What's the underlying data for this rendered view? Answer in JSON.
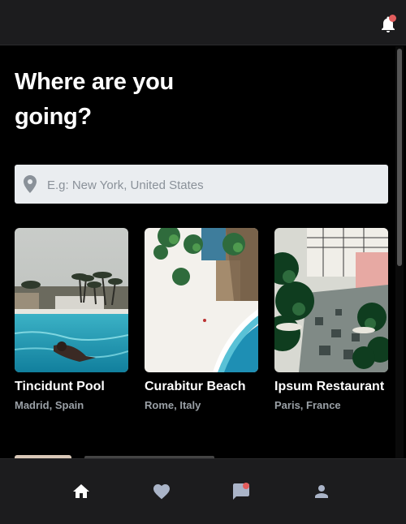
{
  "header": {
    "notification_icon": "bell-icon",
    "has_unread": true
  },
  "main": {
    "heading": "Where are you going?",
    "search": {
      "placeholder": "E.g: New York, United States",
      "icon": "map-pin-icon"
    },
    "places": [
      {
        "title": "Tincidunt Pool",
        "location": "Madrid, Spain"
      },
      {
        "title": "Curabitur Beach",
        "location": "Rome, Italy"
      },
      {
        "title": "Ipsum Restaurant",
        "location": "Paris, France"
      }
    ]
  },
  "bottom_nav": {
    "items": [
      {
        "icon": "home-icon",
        "active": true
      },
      {
        "icon": "heart-icon",
        "active": false
      },
      {
        "icon": "chat-icon",
        "active": false,
        "badge": true
      },
      {
        "icon": "person-icon",
        "active": false
      }
    ]
  },
  "colors": {
    "accent_badge": "#e35d5d",
    "bar_bg": "#1c1c1e",
    "icon_inactive": "#aab4c8"
  }
}
